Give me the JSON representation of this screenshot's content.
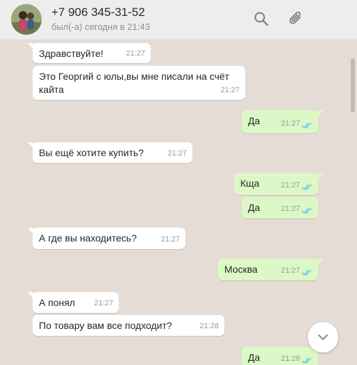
{
  "header": {
    "contact_name": "+7 906 345-31-52",
    "last_seen": "был(-а) сегодня в 21:43",
    "icons": [
      "search-icon",
      "attach-icon"
    ]
  },
  "messages": [
    {
      "dir": "in",
      "text": "Здравствуйте!",
      "time": "21:27"
    },
    {
      "dir": "in",
      "text": "Это Георгий с юлы,вы мне писали на счёт кайта",
      "time": "21:27"
    },
    {
      "dir": "out",
      "text": "Да",
      "time": "21:27",
      "status": "read"
    },
    {
      "dir": "in",
      "text": "Вы ещё хотите купить?",
      "time": "21:27"
    },
    {
      "dir": "out",
      "text": "Кща",
      "time": "21:27",
      "status": "read"
    },
    {
      "dir": "out",
      "text": "Да",
      "time": "21:27",
      "status": "read"
    },
    {
      "dir": "in",
      "text": "А где вы находитесь?",
      "time": "21:27"
    },
    {
      "dir": "out",
      "text": "Москва",
      "time": "21:27",
      "status": "read"
    },
    {
      "dir": "in",
      "text": "А понял",
      "time": "21:27"
    },
    {
      "dir": "in",
      "text": "По товару вам все подходит?",
      "time": "21:28"
    },
    {
      "dir": "out",
      "text": "Да",
      "time": "21:28",
      "status": "read"
    }
  ],
  "colors": {
    "incoming": "#ffffff",
    "outgoing": "#dcf8c6",
    "chat_bg": "#e5ddd5",
    "read_tick": "#4fc3f7"
  }
}
